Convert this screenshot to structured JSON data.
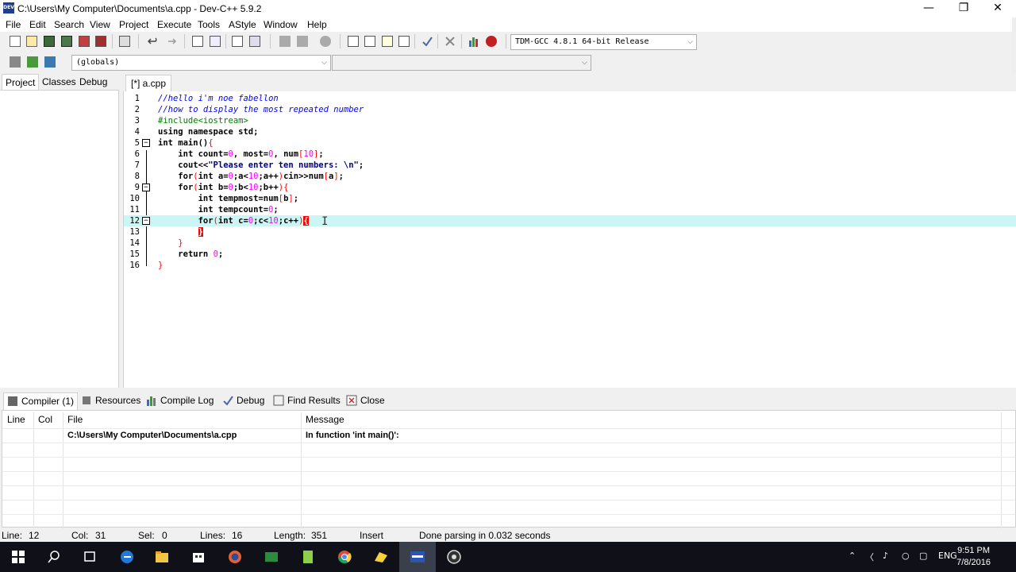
{
  "window": {
    "title": "C:\\Users\\My Computer\\Documents\\a.cpp - Dev-C++ 5.9.2",
    "app_icon_text": "DEV",
    "minimize_glyph": "—",
    "restore_glyph": "❐",
    "close_glyph": "✕"
  },
  "menu": [
    "File",
    "Edit",
    "Search",
    "View",
    "Project",
    "Execute",
    "Tools",
    "AStyle",
    "Window",
    "Help"
  ],
  "toolbar": {
    "compiler_select": "TDM-GCC 4.8.1 64-bit Release",
    "scope_select": "(globals)",
    "function_select": "",
    "icons": [
      "new-file-icon",
      "open-file-icon",
      "save-icon",
      "save-all-icon",
      "close-file-icon",
      "close-all-icon",
      "print-icon",
      "undo-icon",
      "redo-icon",
      "find-icon",
      "replace-icon",
      "goto-line-icon",
      "toggle-bookmark-icon",
      "indent-icon",
      "unindent-icon",
      "new-project-icon",
      "insert-icon",
      "toggle-comment-icon",
      "compile-icon",
      "run-icon",
      "compile-run-icon",
      "rebuild-icon",
      "check-syntax-icon",
      "stop-icon",
      "profile-icon",
      "debug-icon"
    ]
  },
  "left_tabs": [
    "Project",
    "Classes",
    "Debug"
  ],
  "editor": {
    "tab_label": "[*] a.cpp",
    "current_line": 12
  },
  "bottom_tabs": [
    "Compiler (1)",
    "Resources",
    "Compile Log",
    "Debug",
    "Find Results",
    "Close"
  ],
  "messages": {
    "columns": [
      "Line",
      "Col",
      "File",
      "Message"
    ],
    "rows": [
      {
        "line": "",
        "col": "",
        "file": "C:\\Users\\My Computer\\Documents\\a.cpp",
        "message": "In function 'int main()':"
      }
    ]
  },
  "status": {
    "line_label": "Line:",
    "line_value": "12",
    "col_label": "Col:",
    "col_value": "31",
    "sel_label": "Sel:",
    "sel_value": "0",
    "lines_label": "Lines:",
    "lines_value": "16",
    "length_label": "Length:",
    "length_value": "351",
    "mode": "Insert",
    "message": "Done parsing in 0.032 seconds"
  },
  "taskbar": {
    "lang": "ENG",
    "time": "9:51 PM",
    "date": "7/8/2016",
    "apps": [
      "start-icon",
      "search-icon",
      "task-view-icon",
      "edge-icon",
      "file-explorer-icon",
      "store-icon",
      "firefox-icon",
      "excel-icon",
      "notepad-plus-icon",
      "chrome-icon",
      "folder-icon",
      "devcpp-icon",
      "obs-icon"
    ]
  },
  "colors": {
    "comment": "#0000ff",
    "preprocessor": "#008000",
    "number": "#ff00ff",
    "symbol": "#ff0000",
    "current_line": "#ccf5f5",
    "taskbar": "#101018"
  }
}
